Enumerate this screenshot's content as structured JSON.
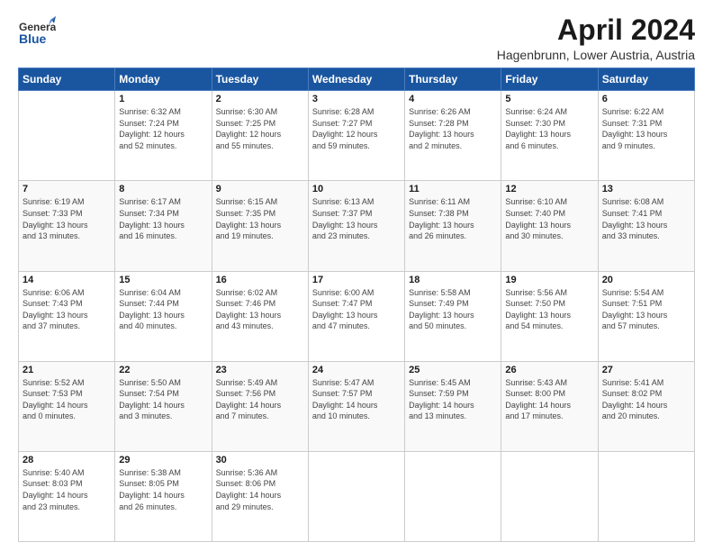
{
  "header": {
    "logo_general": "General",
    "logo_blue": "Blue",
    "title": "April 2024",
    "location": "Hagenbrunn, Lower Austria, Austria"
  },
  "days": [
    "Sunday",
    "Monday",
    "Tuesday",
    "Wednesday",
    "Thursday",
    "Friday",
    "Saturday"
  ],
  "weeks": [
    [
      {
        "date": "",
        "info": ""
      },
      {
        "date": "1",
        "info": "Sunrise: 6:32 AM\nSunset: 7:24 PM\nDaylight: 12 hours\nand 52 minutes."
      },
      {
        "date": "2",
        "info": "Sunrise: 6:30 AM\nSunset: 7:25 PM\nDaylight: 12 hours\nand 55 minutes."
      },
      {
        "date": "3",
        "info": "Sunrise: 6:28 AM\nSunset: 7:27 PM\nDaylight: 12 hours\nand 59 minutes."
      },
      {
        "date": "4",
        "info": "Sunrise: 6:26 AM\nSunset: 7:28 PM\nDaylight: 13 hours\nand 2 minutes."
      },
      {
        "date": "5",
        "info": "Sunrise: 6:24 AM\nSunset: 7:30 PM\nDaylight: 13 hours\nand 6 minutes."
      },
      {
        "date": "6",
        "info": "Sunrise: 6:22 AM\nSunset: 7:31 PM\nDaylight: 13 hours\nand 9 minutes."
      }
    ],
    [
      {
        "date": "7",
        "info": "Sunrise: 6:19 AM\nSunset: 7:33 PM\nDaylight: 13 hours\nand 13 minutes."
      },
      {
        "date": "8",
        "info": "Sunrise: 6:17 AM\nSunset: 7:34 PM\nDaylight: 13 hours\nand 16 minutes."
      },
      {
        "date": "9",
        "info": "Sunrise: 6:15 AM\nSunset: 7:35 PM\nDaylight: 13 hours\nand 19 minutes."
      },
      {
        "date": "10",
        "info": "Sunrise: 6:13 AM\nSunset: 7:37 PM\nDaylight: 13 hours\nand 23 minutes."
      },
      {
        "date": "11",
        "info": "Sunrise: 6:11 AM\nSunset: 7:38 PM\nDaylight: 13 hours\nand 26 minutes."
      },
      {
        "date": "12",
        "info": "Sunrise: 6:10 AM\nSunset: 7:40 PM\nDaylight: 13 hours\nand 30 minutes."
      },
      {
        "date": "13",
        "info": "Sunrise: 6:08 AM\nSunset: 7:41 PM\nDaylight: 13 hours\nand 33 minutes."
      }
    ],
    [
      {
        "date": "14",
        "info": "Sunrise: 6:06 AM\nSunset: 7:43 PM\nDaylight: 13 hours\nand 37 minutes."
      },
      {
        "date": "15",
        "info": "Sunrise: 6:04 AM\nSunset: 7:44 PM\nDaylight: 13 hours\nand 40 minutes."
      },
      {
        "date": "16",
        "info": "Sunrise: 6:02 AM\nSunset: 7:46 PM\nDaylight: 13 hours\nand 43 minutes."
      },
      {
        "date": "17",
        "info": "Sunrise: 6:00 AM\nSunset: 7:47 PM\nDaylight: 13 hours\nand 47 minutes."
      },
      {
        "date": "18",
        "info": "Sunrise: 5:58 AM\nSunset: 7:49 PM\nDaylight: 13 hours\nand 50 minutes."
      },
      {
        "date": "19",
        "info": "Sunrise: 5:56 AM\nSunset: 7:50 PM\nDaylight: 13 hours\nand 54 minutes."
      },
      {
        "date": "20",
        "info": "Sunrise: 5:54 AM\nSunset: 7:51 PM\nDaylight: 13 hours\nand 57 minutes."
      }
    ],
    [
      {
        "date": "21",
        "info": "Sunrise: 5:52 AM\nSunset: 7:53 PM\nDaylight: 14 hours\nand 0 minutes."
      },
      {
        "date": "22",
        "info": "Sunrise: 5:50 AM\nSunset: 7:54 PM\nDaylight: 14 hours\nand 3 minutes."
      },
      {
        "date": "23",
        "info": "Sunrise: 5:49 AM\nSunset: 7:56 PM\nDaylight: 14 hours\nand 7 minutes."
      },
      {
        "date": "24",
        "info": "Sunrise: 5:47 AM\nSunset: 7:57 PM\nDaylight: 14 hours\nand 10 minutes."
      },
      {
        "date": "25",
        "info": "Sunrise: 5:45 AM\nSunset: 7:59 PM\nDaylight: 14 hours\nand 13 minutes."
      },
      {
        "date": "26",
        "info": "Sunrise: 5:43 AM\nSunset: 8:00 PM\nDaylight: 14 hours\nand 17 minutes."
      },
      {
        "date": "27",
        "info": "Sunrise: 5:41 AM\nSunset: 8:02 PM\nDaylight: 14 hours\nand 20 minutes."
      }
    ],
    [
      {
        "date": "28",
        "info": "Sunrise: 5:40 AM\nSunset: 8:03 PM\nDaylight: 14 hours\nand 23 minutes."
      },
      {
        "date": "29",
        "info": "Sunrise: 5:38 AM\nSunset: 8:05 PM\nDaylight: 14 hours\nand 26 minutes."
      },
      {
        "date": "30",
        "info": "Sunrise: 5:36 AM\nSunset: 8:06 PM\nDaylight: 14 hours\nand 29 minutes."
      },
      {
        "date": "",
        "info": ""
      },
      {
        "date": "",
        "info": ""
      },
      {
        "date": "",
        "info": ""
      },
      {
        "date": "",
        "info": ""
      }
    ]
  ]
}
